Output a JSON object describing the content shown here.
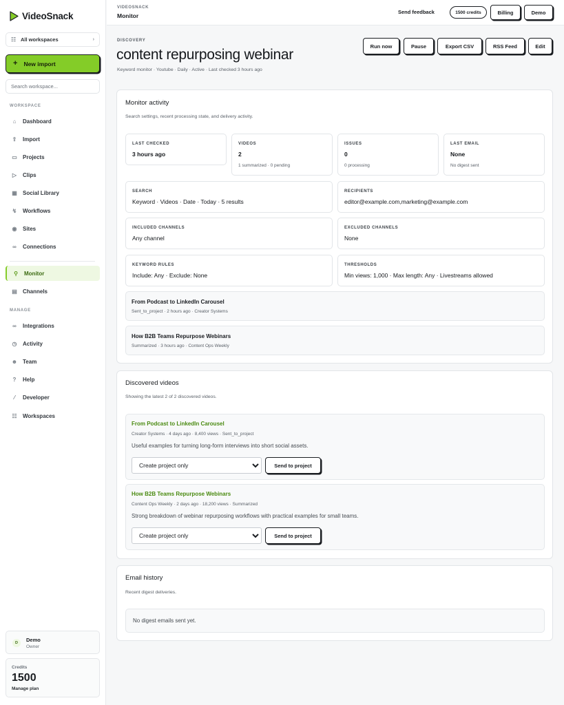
{
  "app": {
    "name": "VideoSnack",
    "brand_color": "#84cc28"
  },
  "sidebar": {
    "workspace_select": "All workspaces",
    "new_import": "New import",
    "search_placeholder": "Search workspace...",
    "section_workspace": "WORKSPACE",
    "section_manage": "MANAGE",
    "items": [
      {
        "label": "Dashboard",
        "icon": "home-icon"
      },
      {
        "label": "Import",
        "icon": "upload-icon"
      },
      {
        "label": "Projects",
        "icon": "folder-icon"
      },
      {
        "label": "Clips",
        "icon": "video-icon"
      },
      {
        "label": "Social Library",
        "icon": "grid-icon"
      },
      {
        "label": "Workflows",
        "icon": "bolt-icon"
      },
      {
        "label": "Sites",
        "icon": "globe-icon"
      },
      {
        "label": "Connections",
        "icon": "link-icon"
      },
      {
        "label": "Monitor",
        "icon": "search-icon",
        "active": true
      },
      {
        "label": "Channels",
        "icon": "chart-icon"
      }
    ],
    "manage_items": [
      {
        "label": "Integrations",
        "icon": "link-icon"
      },
      {
        "label": "Activity",
        "icon": "clock-icon"
      },
      {
        "label": "Team",
        "icon": "users-icon"
      },
      {
        "label": "Help",
        "icon": "help-icon"
      },
      {
        "label": "Developer",
        "icon": "wrench-icon"
      },
      {
        "label": "Workspaces",
        "icon": "workspace-icon"
      }
    ],
    "user": {
      "initial": "D",
      "name": "Demo",
      "role": "Owner"
    },
    "credits": {
      "label": "Credits",
      "value": "1500",
      "link": "Manage plan"
    }
  },
  "topbar": {
    "app_label": "VIDEOSNACK",
    "page_label": "Monitor",
    "feedback": "Send feedback",
    "credits_pill": "1500 credits",
    "billing": "Billing",
    "user": "Demo"
  },
  "header": {
    "kicker": "DISCOVERY",
    "title": "content repurposing webinar",
    "subtitle": "Keyword monitor · Youtube · Daily · Active · Last checked 3 hours ago",
    "actions": [
      "Run now",
      "Pause",
      "Export CSV",
      "RSS Feed",
      "Edit"
    ]
  },
  "activity": {
    "title": "Monitor activity",
    "subtitle": "Search settings, recent processing state, and delivery activity.",
    "stats": [
      {
        "label": "LAST CHECKED",
        "value": "3 hours ago",
        "meta": ""
      },
      {
        "label": "VIDEOS",
        "value": "2",
        "meta": "1 summarized · 0 pending"
      },
      {
        "label": "ISSUES",
        "value": "0",
        "meta": "0 processing"
      },
      {
        "label": "LAST EMAIL",
        "value": "None",
        "meta": "No digest sent"
      }
    ],
    "details": [
      {
        "label": "SEARCH",
        "value": "Keyword · Videos · Date · Today · 5 results"
      },
      {
        "label": "RECIPIENTS",
        "value": "editor@example.com,marketing@example.com"
      },
      {
        "label": "INCLUDED CHANNELS",
        "value": "Any channel"
      },
      {
        "label": "EXCLUDED CHANNELS",
        "value": "None"
      },
      {
        "label": "KEYWORD RULES",
        "value": "Include: Any · Exclude: None"
      },
      {
        "label": "THRESHOLDS",
        "value": "Min views: 1,000 · Max length: Any · Livestreams allowed"
      }
    ],
    "recent": [
      {
        "title": "From Podcast to LinkedIn Carousel",
        "meta": "Sent_to_project · 2 hours ago · Creator Systems"
      },
      {
        "title": "How B2B Teams Repurpose Webinars",
        "meta": "Summarized · 3 hours ago · Content Ops Weekly"
      }
    ]
  },
  "discovered": {
    "title": "Discovered videos",
    "subtitle": "Showing the latest 2 of 2 discovered videos.",
    "videos": [
      {
        "title": "From Podcast to LinkedIn Carousel",
        "meta": "Creator Systems · 4 days ago · 8,400 views · Sent_to_project",
        "description": "Useful examples for turning long-form interviews into short social assets.",
        "select_value": "Create project only",
        "action": "Send to project"
      },
      {
        "title": "How B2B Teams Repurpose Webinars",
        "meta": "Content Ops Weekly · 2 days ago · 18,200 views · Summarized",
        "description": "Strong breakdown of webinar repurposing workflows with practical examples for small teams.",
        "select_value": "Create project only",
        "action": "Send to project"
      }
    ]
  },
  "email_history": {
    "title": "Email history",
    "subtitle": "Recent digest deliveries.",
    "empty": "No digest emails sent yet."
  }
}
